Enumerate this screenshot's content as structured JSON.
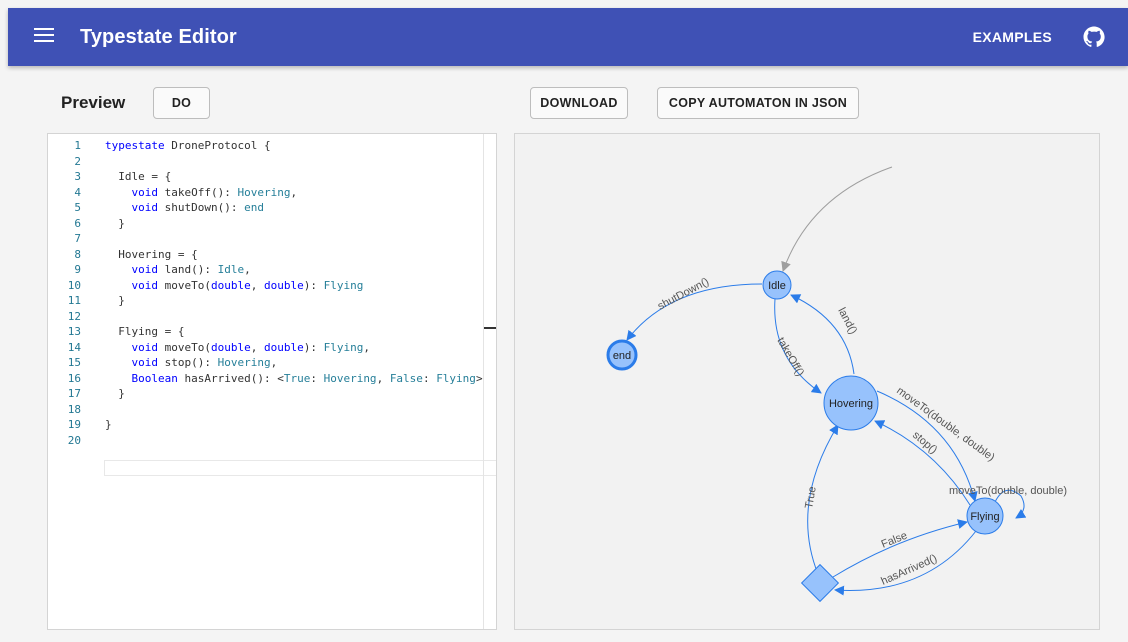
{
  "app": {
    "title": "Typestate Editor",
    "examples_label": "EXAMPLES"
  },
  "toolbar": {
    "preview_label": "Preview",
    "do_label": "DO",
    "download_label": "DOWNLOAD",
    "copy_label": "COPY AUTOMATON IN JSON"
  },
  "editor": {
    "lines": [
      {
        "n": "1",
        "text": "typestate DroneProtocol {"
      },
      {
        "n": "2",
        "text": ""
      },
      {
        "n": "3",
        "text": "  Idle = {"
      },
      {
        "n": "4",
        "text": "    void takeOff(): Hovering,"
      },
      {
        "n": "5",
        "text": "    void shutDown(): end"
      },
      {
        "n": "6",
        "text": "  }"
      },
      {
        "n": "7",
        "text": ""
      },
      {
        "n": "8",
        "text": "  Hovering = {"
      },
      {
        "n": "9",
        "text": "    void land(): Idle,"
      },
      {
        "n": "10",
        "text": "    void moveTo(double, double): Flying"
      },
      {
        "n": "11",
        "text": "  }"
      },
      {
        "n": "12",
        "text": ""
      },
      {
        "n": "13",
        "text": "  Flying = {"
      },
      {
        "n": "14",
        "text": "    void moveTo(double, double): Flying,"
      },
      {
        "n": "15",
        "text": "    void stop(): Hovering,"
      },
      {
        "n": "16",
        "text": "    Boolean hasArrived(): <True: Hovering, False: Flying>"
      },
      {
        "n": "17",
        "text": "  }"
      },
      {
        "n": "18",
        "text": ""
      },
      {
        "n": "19",
        "text": "}"
      },
      {
        "n": "20",
        "text": ""
      }
    ]
  },
  "graph": {
    "nodes": {
      "idle": "Idle",
      "end": "end",
      "hovering": "Hovering",
      "flying": "Flying"
    },
    "edges": {
      "shutdown": "shutDown()",
      "land": "land()",
      "takeoff": "takeOff()",
      "moveto_hf": "moveTo(double, double)",
      "stop": "stop()",
      "moveto_ff": "moveTo(double, double)",
      "true": "True",
      "false": "False",
      "hasarrived": "hasArrived()"
    }
  },
  "colors": {
    "appbar": "#3f51b5",
    "node_fill": "#97c2fc",
    "node_border": "#2b7ce9",
    "edge": "#2b7ce9",
    "initial_edge": "#9e9e9e"
  },
  "icons": [
    "menu-icon",
    "github-icon"
  ]
}
